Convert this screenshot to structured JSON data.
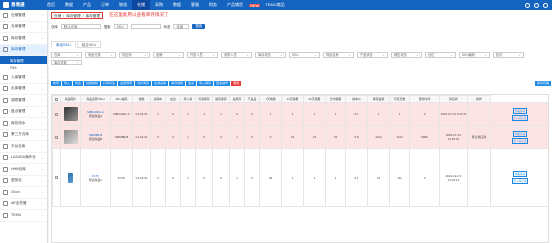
{
  "app": {
    "logo_text": "易境通",
    "colors": {
      "brand": "#1565c0",
      "highlight": "#fde4e4",
      "accent_red": "#e53935"
    }
  },
  "topnav": {
    "items": [
      "首页",
      "数据",
      "产品",
      "订单",
      "物流",
      "仓储",
      "采购",
      "数据",
      "客服",
      "财务",
      "产品铺货",
      "TEMU商品"
    ],
    "new_badge": "NEW",
    "active_index": 5
  },
  "sidebar": {
    "items": [
      {
        "label": "仓储管理",
        "icon": "warehouse-icon"
      },
      {
        "label": "仓库管理",
        "icon": "building-icon"
      },
      {
        "label": "库存管理",
        "icon": "box-icon"
      },
      {
        "label": "库存管理",
        "icon": "stock-icon",
        "active": true
      }
    ],
    "sub_items": [
      {
        "label": "库存管理",
        "active": true
      },
      {
        "label": "FBA"
      }
    ],
    "items2": [
      {
        "label": "入库管理",
        "icon": "inbound-icon"
      },
      {
        "label": "出库管理",
        "icon": "outbound-icon"
      },
      {
        "label": "调拨管理",
        "icon": "transfer-icon"
      },
      {
        "label": "盘点管理",
        "icon": "check-icon"
      },
      {
        "label": "库存流水",
        "icon": "flow-icon"
      },
      {
        "label": "第三方仓库",
        "icon": "third-icon"
      },
      {
        "label": "平台仓库",
        "icon": "platform-icon"
      },
      {
        "label": "LAZADA海外仓",
        "icon": "lazada-icon"
      },
      {
        "label": "HHB仓库",
        "icon": "hhb-icon"
      },
      {
        "label": "虚拟仓",
        "icon": "virtual-icon"
      },
      {
        "label": "Ozon",
        "icon": "ozon-icon"
      },
      {
        "label": "AE全托管",
        "icon": "ae-icon"
      },
      {
        "label": "TEMU",
        "icon": "temu-icon"
      }
    ]
  },
  "breadcrumb": {
    "items": [
      "仓储",
      "库存管理",
      "库存管理"
    ]
  },
  "note": "在这里能用以查看库存情况了",
  "filters": {
    "warehouse_label": "仓库",
    "warehouse_value": "默认仓库",
    "search_label": "搜索",
    "search_value": "SKU",
    "status_label": "状态",
    "status_value": "全部",
    "search_button": "搜索"
  },
  "tabs": [
    "单品SKU",
    "组合SKU"
  ],
  "filters2": [
    "仓库",
    "商品分类",
    "供应商",
    "品牌",
    "开发人员",
    "采购人员",
    "库存状态",
    "SKU",
    "商品名称",
    "产品状态",
    "销售状态",
    "仓位",
    "SKU编码",
    "批次",
    "库存天数"
  ],
  "actions": [
    "新增",
    "导入",
    "导出",
    "批量编辑",
    "打印标签",
    "设置预警",
    "同步库存",
    "生成采购",
    "库存调整",
    "盘点",
    "导入库存",
    "更多操作",
    "删除"
  ],
  "actions_right": [
    "库存管理"
  ],
  "table": {
    "headers": [
      "",
      "商品图片",
      "商品名称/SKU",
      "SKU编码",
      "规格",
      "采购中",
      "在途",
      "待入库",
      "可用库存",
      "锁定库存",
      "总库存",
      "不良品",
      "7天销量",
      "14天销量",
      "30天销量",
      "日均销量",
      "成本价",
      "库存金额",
      "可售天数",
      "更新时间",
      "供应商",
      "操作"
    ],
    "rows": [
      {
        "hl": true,
        "img": "t1",
        "name": "测试商品A",
        "sku": "MBN-RZG-A",
        "spec": "3.4.01-01",
        "cells": [
          "1",
          "0",
          "1",
          "-1",
          "1",
          "0",
          "0",
          "1",
          "1",
          "1",
          "1",
          "0.1"
        ],
        "cost": "1",
        "value": "1",
        "days": "0",
        "time": "2023-07-3\n0 9:12:11",
        "supplier": "",
        "ops": [
          "查看库存",
          "出入库记录"
        ]
      },
      {
        "hl": true,
        "img": "t2",
        "name": "测试商品B",
        "sku": "NMM8B-B",
        "spec": "3.4.01-01",
        "cells": [
          "0",
          "0",
          "1",
          "0",
          "0",
          "1",
          "0",
          "0",
          "23",
          "23",
          "23",
          "0.8"
        ],
        "cost": "1212",
        "value": "1212",
        "days": "9999",
        "time": "2023-07-3\n0 14:20:23",
        "supplier": "默认供应商",
        "ops": [
          "查看库存",
          "出入库记录"
        ]
      },
      {
        "hl": false,
        "img": "t3",
        "name": "测试商品C",
        "sku": "FCTF",
        "spec": "3.4.01-01",
        "cells": [
          "0",
          "0",
          "1",
          "0",
          "0",
          "1",
          "0",
          "48",
          "1",
          "1",
          "1",
          "0.1"
        ],
        "cost": "12",
        "value": "111",
        "days": "0",
        "time": "2021-12-2\n3 14:23:21",
        "supplier": "",
        "ops": [
          "查看库存",
          "出入库记录"
        ]
      }
    ]
  }
}
